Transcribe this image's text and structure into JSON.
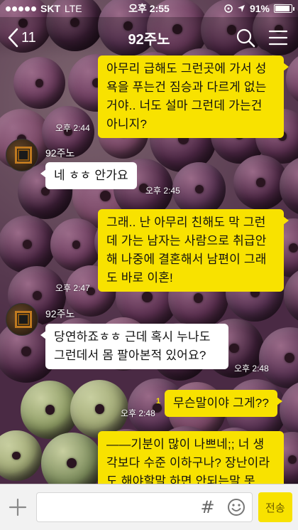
{
  "status_bar": {
    "carrier": "SKT",
    "network": "LTE",
    "time": "오후 2:55",
    "battery_text": "91%",
    "battery_level": 0.91
  },
  "nav": {
    "back_count": "11",
    "title": "92주노"
  },
  "messages": [
    {
      "type": "me",
      "text": "아무리 급해도 그런곳에 가서 성욕을 푸는건 짐승과 다르게 없는거야.. 너도 설마 그런데 가는건 아니지?",
      "time": "오후 2:44"
    },
    {
      "type": "other",
      "sender": "92주노",
      "text": "네 ㅎㅎ 안가요",
      "time": "오후 2:45"
    },
    {
      "type": "me",
      "text": "그래.. 난 아무리 친해도 막 그런데 가는 남자는 사람으로 취급안해 나중에 결혼해서 남편이 그래도 바로 이혼!",
      "time": "오후 2:47"
    },
    {
      "type": "other",
      "sender": "92주노",
      "text": "당연하죠ㅎㅎ 근데 혹시 누나도 그런데서 몸 팔아본적 있어요?",
      "time": "오후 2:48"
    },
    {
      "type": "me",
      "text": "무슨말이야 그게??",
      "time": "오후 2:48",
      "unread": "1"
    },
    {
      "type": "me",
      "text": "——기분이 많이 나쁘네;; 너 생각보다 수준 이하구나? 장난이라도 해야할말 하면 안되는말 못"
    }
  ],
  "input": {
    "placeholder": "",
    "hash_icon": "#",
    "send_label": "전송"
  },
  "colors": {
    "my_bubble": "#f8e200",
    "other_bubble": "#ffffff",
    "wallpaper": "#4a2a44"
  }
}
